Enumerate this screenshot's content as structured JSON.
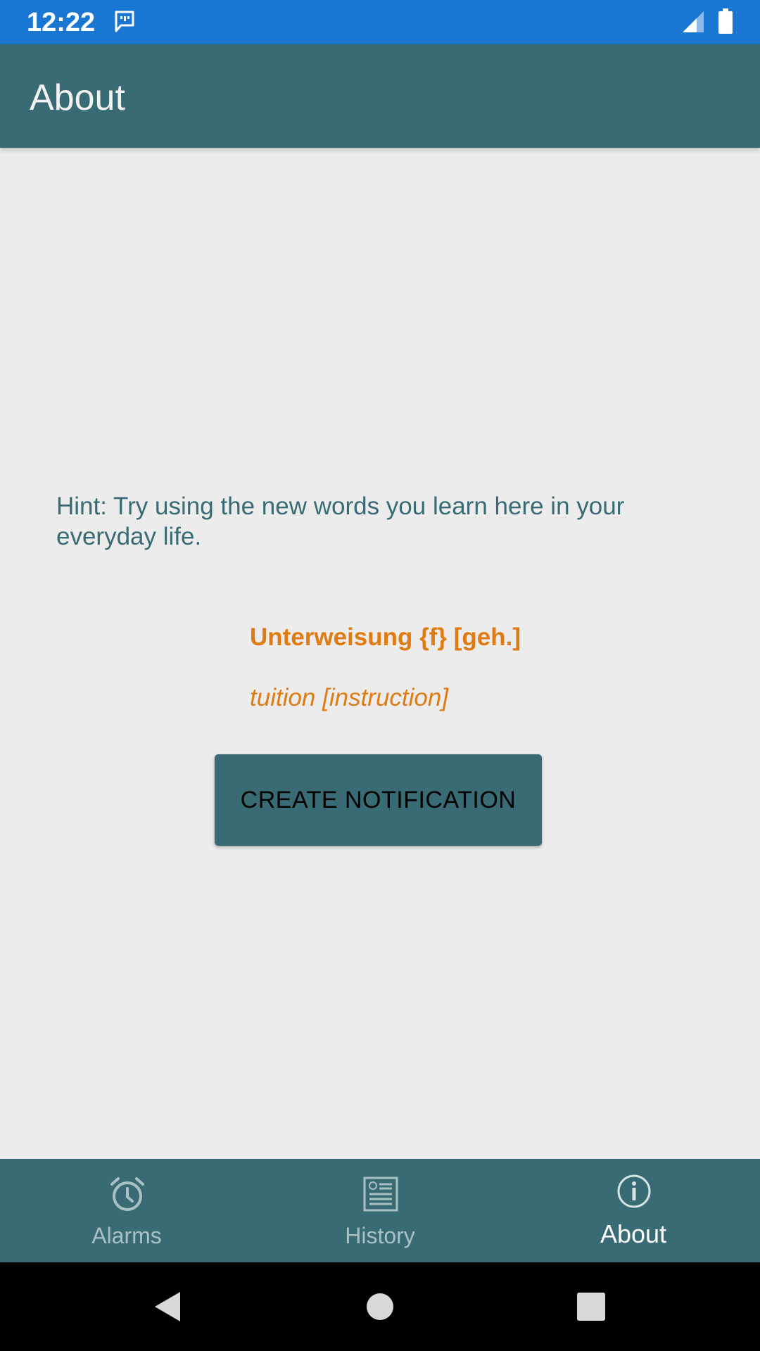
{
  "status_bar": {
    "time": "12:22",
    "color": "#1976d2",
    "icons": [
      "message-icon",
      "signal-icon",
      "battery-icon"
    ]
  },
  "app_bar": {
    "title": "About",
    "color": "#386b73"
  },
  "content": {
    "hint": "Hint: Try using the new words you learn here in your everyday life.",
    "word_term": "Unterweisung {f} [geh.]",
    "word_translation": "tuition [instruction]",
    "accent_color": "#e07b12",
    "create_button_label": "CREATE NOTIFICATION"
  },
  "bottom_nav": {
    "items": [
      {
        "label": "Alarms",
        "icon": "alarm-clock-icon",
        "active": false
      },
      {
        "label": "History",
        "icon": "history-list-icon",
        "active": false
      },
      {
        "label": "About",
        "icon": "info-icon",
        "active": true
      }
    ]
  },
  "system_nav": {
    "icons": [
      "back-icon",
      "home-icon",
      "recents-icon"
    ]
  }
}
